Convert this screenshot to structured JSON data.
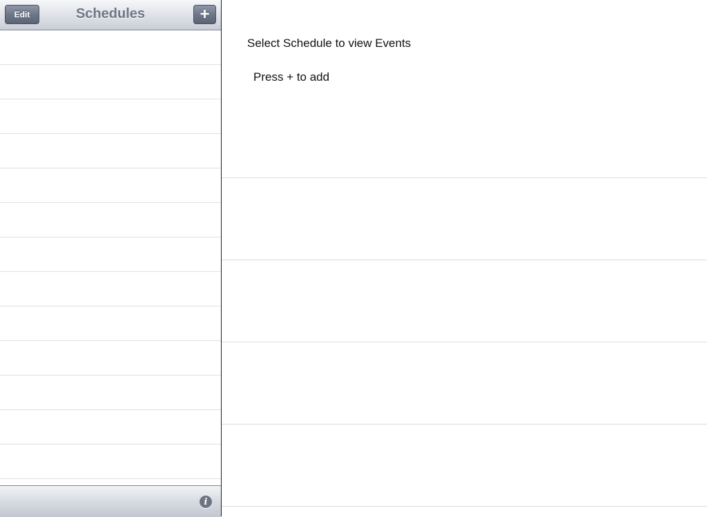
{
  "master": {
    "title": "Schedules",
    "edit_label": "Edit",
    "add_label": "+",
    "row_count": 13
  },
  "toolbar": {
    "info_icon": "info-icon",
    "info_glyph": "i"
  },
  "detail": {
    "message": "Select Schedule to view Events",
    "hint": "Press + to add"
  },
  "colors": {
    "nav_title": "#6e7685",
    "button": "#6e7789",
    "separator": "#e0e0e0"
  }
}
